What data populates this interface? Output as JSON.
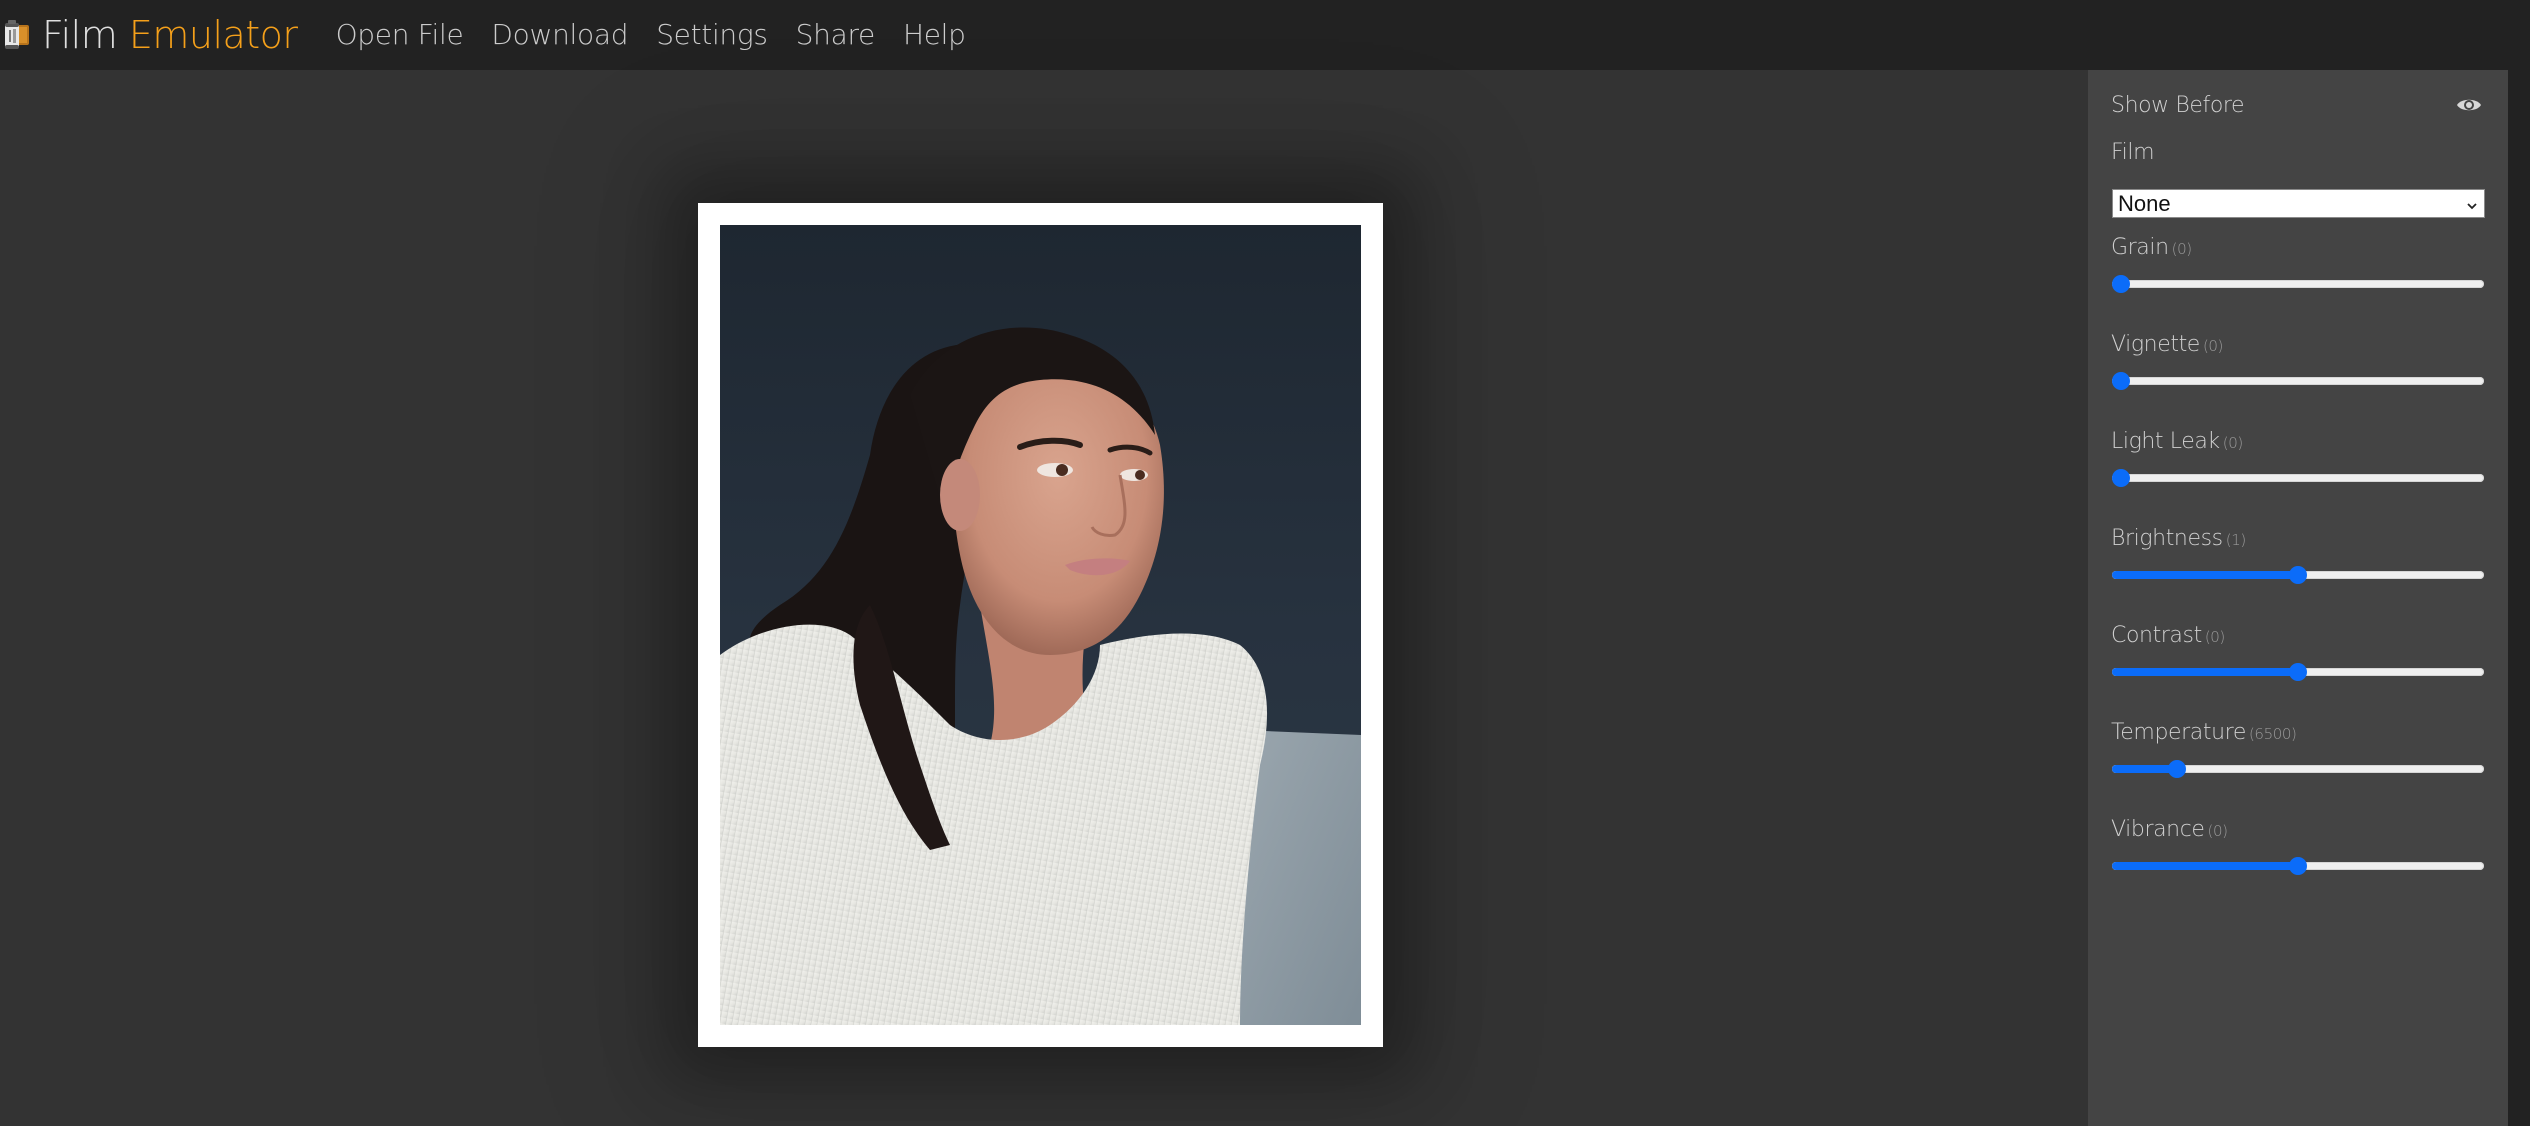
{
  "app": {
    "title_part1": "Film",
    "title_part2": "Emulator",
    "logo_icon": "film-canister-icon",
    "accent_color": "#f5a01a"
  },
  "nav": {
    "items": [
      {
        "label": "Open File"
      },
      {
        "label": "Download"
      },
      {
        "label": "Settings"
      },
      {
        "label": "Share"
      },
      {
        "label": "Help"
      }
    ]
  },
  "canvas": {
    "image_description": "Portrait photo of a young woman with a dark ponytail in a white ribbed sweater, looking to the right, against a dark navy wall",
    "frame_color": "#ffffff"
  },
  "sidebar": {
    "show_before": {
      "label": "Show Before",
      "icon": "eye-icon"
    },
    "film": {
      "label": "Film",
      "selected": "None"
    },
    "slider_color": "#0b6cf9",
    "sliders": [
      {
        "name": "grain",
        "label": "Grain",
        "value_text": "(0)",
        "fraction": 0.0
      },
      {
        "name": "vignette",
        "label": "Vignette",
        "value_text": "(0)",
        "fraction": 0.0
      },
      {
        "name": "light-leak",
        "label": "Light Leak",
        "value_text": "(0)",
        "fraction": 0.0
      },
      {
        "name": "brightness",
        "label": "Brightness",
        "value_text": "(1)",
        "fraction": 0.5
      },
      {
        "name": "contrast",
        "label": "Contrast",
        "value_text": "(0)",
        "fraction": 0.5
      },
      {
        "name": "temperature",
        "label": "Temperature",
        "value_text": "(6500)",
        "fraction": 0.175
      },
      {
        "name": "vibrance",
        "label": "Vibrance",
        "value_text": "(0)",
        "fraction": 0.5
      }
    ]
  }
}
